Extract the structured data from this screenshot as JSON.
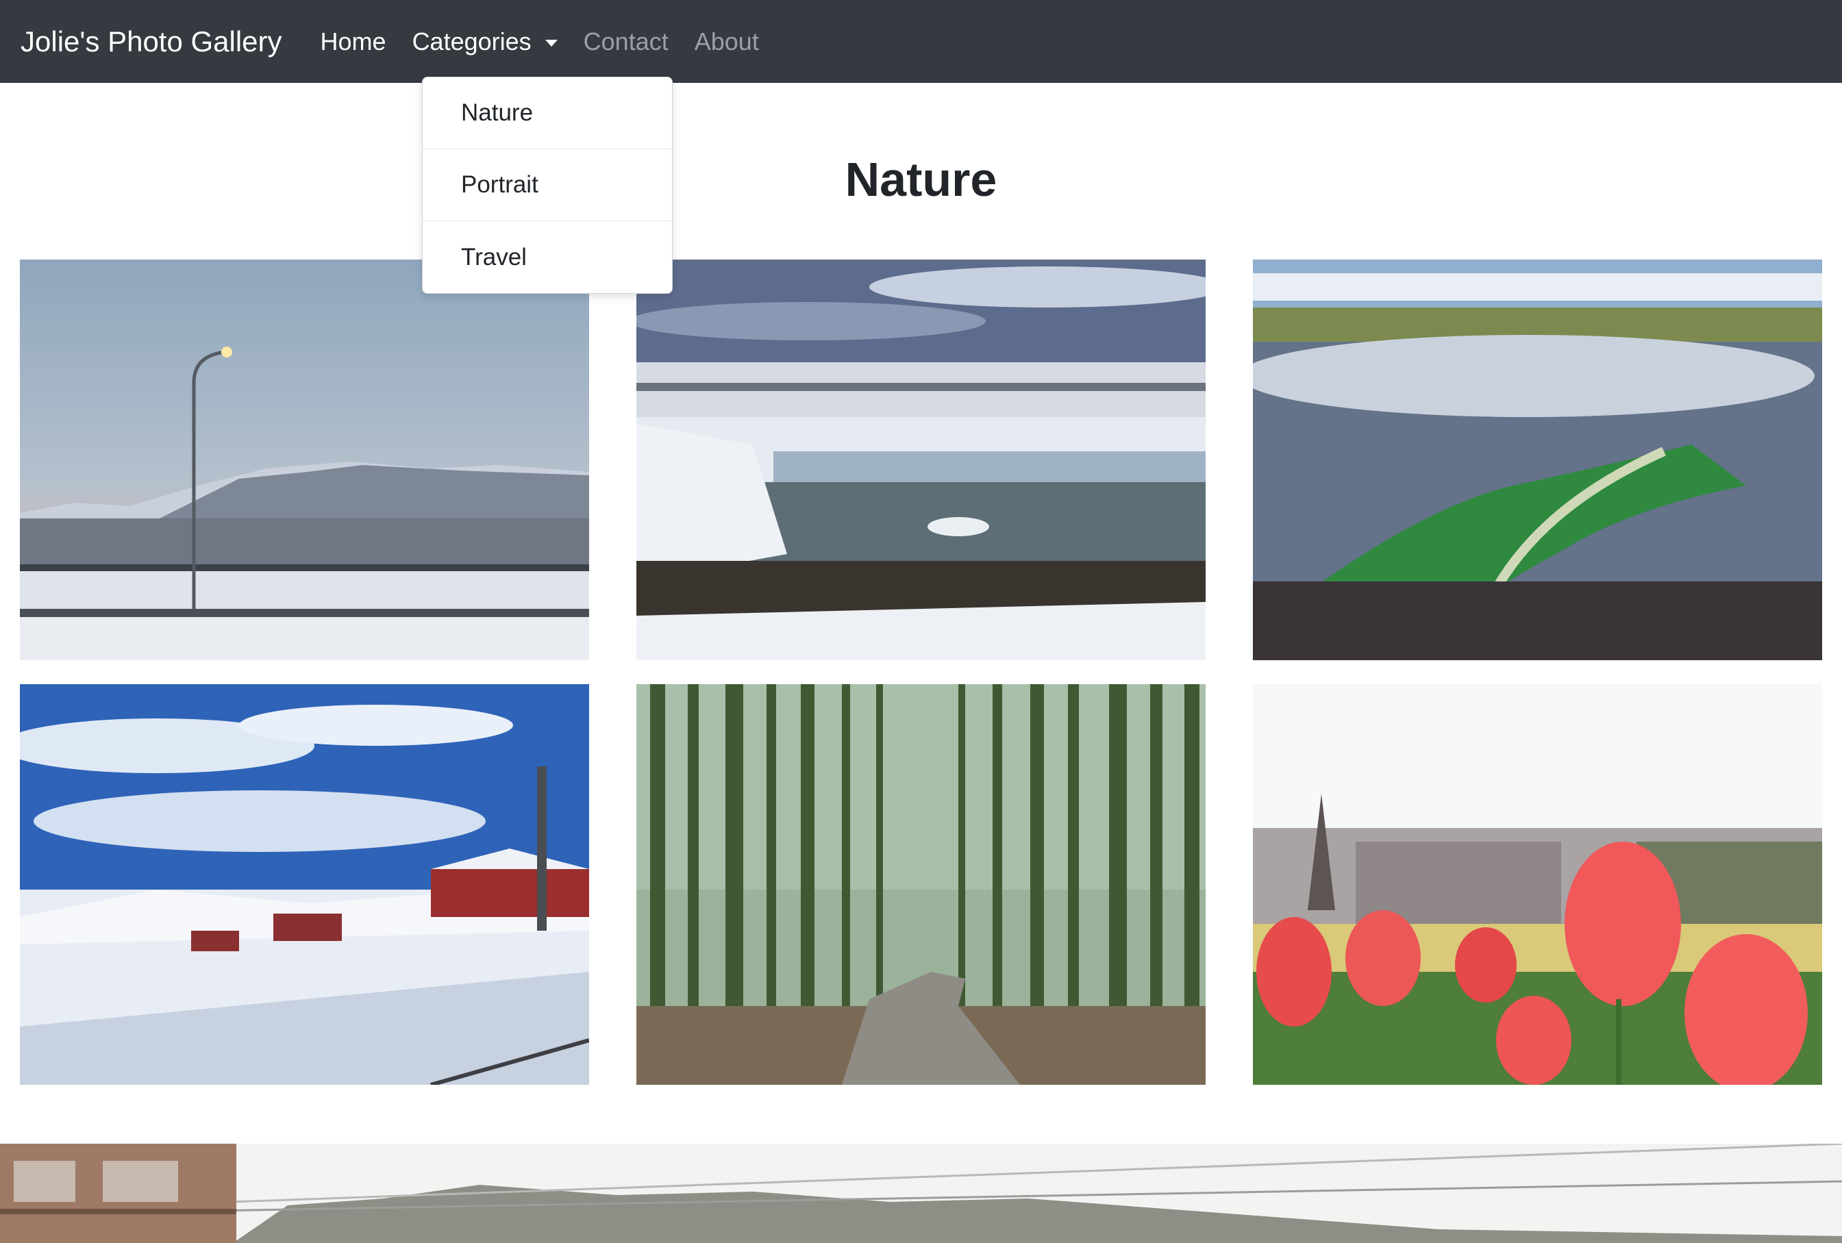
{
  "navbar": {
    "brand": "Jolie's Photo Gallery",
    "links": {
      "home": "Home",
      "categories": "Categories",
      "contact": "Contact",
      "about": "About"
    }
  },
  "dropdown": {
    "items": [
      "Nature",
      "Portrait",
      "Travel"
    ]
  },
  "page": {
    "title": "Nature"
  },
  "colors": {
    "navbar_bg": "#343a40",
    "active_link": "#ffffff",
    "muted_link": "#9aa0a6"
  }
}
